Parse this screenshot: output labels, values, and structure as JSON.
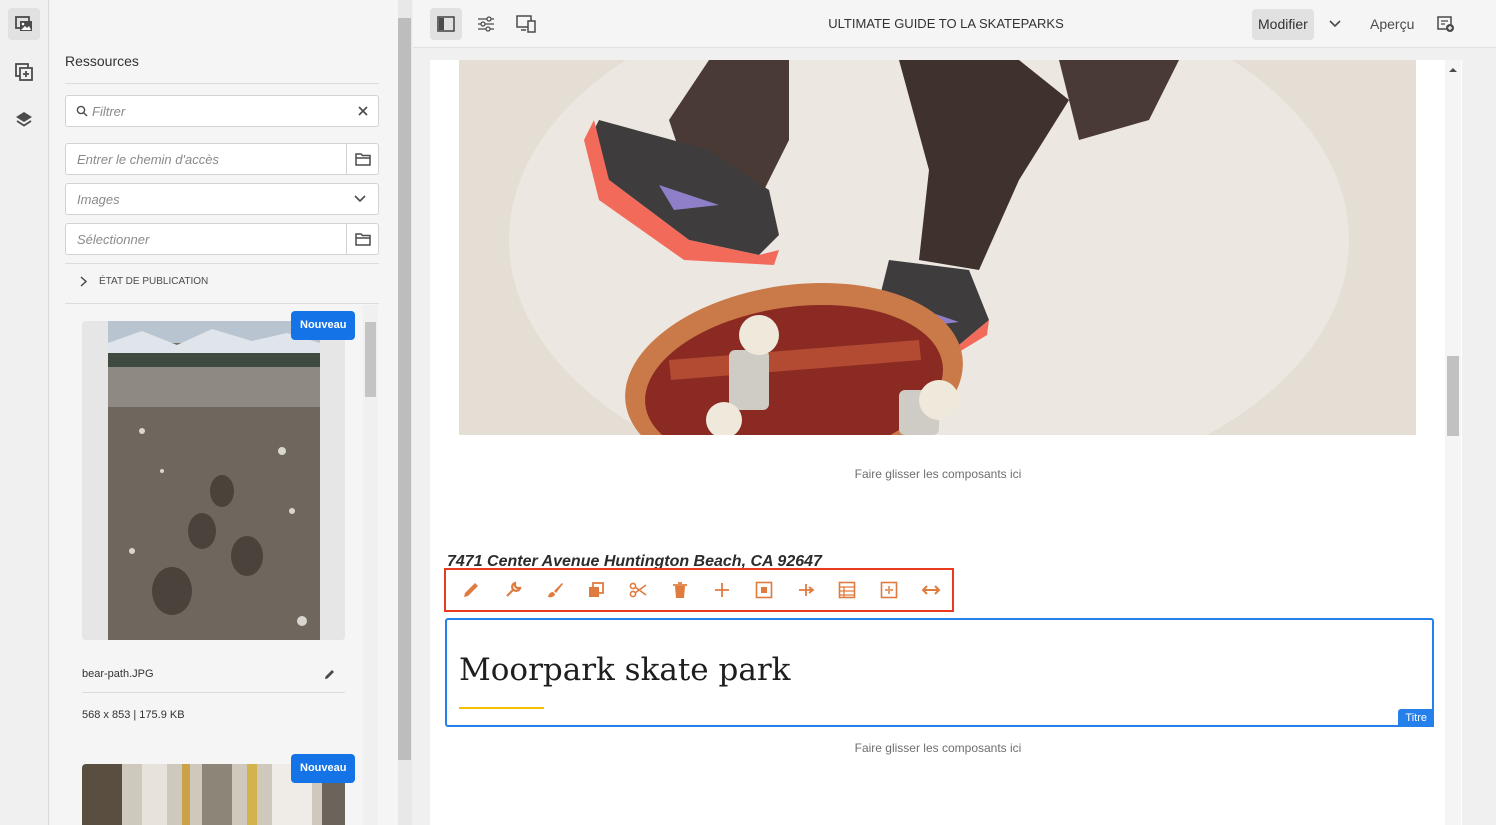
{
  "rail": {
    "items": [
      {
        "name": "assets-icon",
        "active": true
      },
      {
        "name": "components-icon",
        "active": false
      },
      {
        "name": "layers-icon",
        "active": false
      }
    ]
  },
  "panel": {
    "title": "Ressources",
    "filter_placeholder": "Filtrer",
    "path_placeholder": "Entrer le chemin d'accès",
    "type_select": "Images",
    "select_placeholder": "Sélectionner",
    "publish_status": "ÉTAT DE PUBLICATION",
    "assets": [
      {
        "badge": "Nouveau",
        "name": "bear-path.JPG",
        "meta": "568 x 853 | 175.9 KB"
      },
      {
        "badge": "Nouveau"
      }
    ]
  },
  "topbar": {
    "page_title": "ULTIMATE GUIDE TO LA SKATEPARKS",
    "mode": "Modifier",
    "preview": "Aperçu"
  },
  "canvas": {
    "drop_hint_1": "Faire glisser les composants ici",
    "address": "7471 Center Avenue Huntington Beach, CA 92647",
    "title_text": "Moorpark skate park",
    "title_tag": "Titre",
    "drop_hint_2": "Faire glisser les composants ici"
  },
  "toolbar": {
    "tools": [
      "edit-icon",
      "configure-icon",
      "style-icon",
      "copy-icon",
      "cut-icon",
      "delete-icon",
      "insert-icon",
      "group-icon",
      "parent-icon",
      "layout-icon",
      "convert-icon",
      "resize-icon"
    ]
  },
  "colors": {
    "accent": "#1473e6",
    "selection": "#2680eb",
    "toolbar_highlight": "#e83a1f",
    "toolbar_icons": "#e07b3f"
  }
}
